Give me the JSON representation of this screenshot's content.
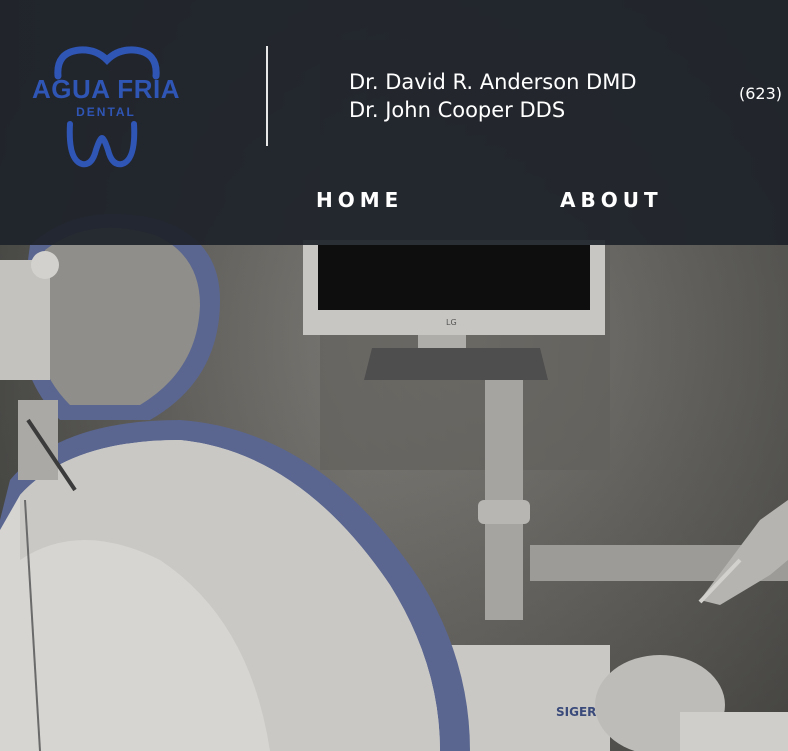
{
  "brand": {
    "name": "AGUA FRIA",
    "tagline": "DENTAL",
    "color": "#2f55b5"
  },
  "header": {
    "doctors": [
      "Dr. David R. Anderson DMD",
      "Dr. John Cooper DDS"
    ],
    "phone": "(623)"
  },
  "nav": {
    "items": [
      {
        "label": "HOME"
      },
      {
        "label": "ABOUT"
      }
    ]
  },
  "hero": {
    "monitor_brand": "LG",
    "chair_brand": "SIGER"
  },
  "colors": {
    "header_bg": "#1e222a",
    "text": "#ffffff",
    "chair_accent": "#56628f"
  }
}
